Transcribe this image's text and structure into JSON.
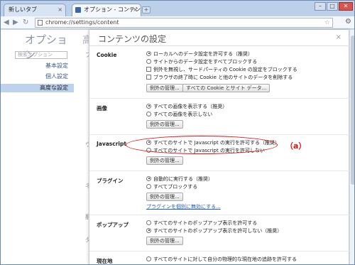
{
  "browser": {
    "tabs": [
      {
        "label": "新しいタブ",
        "active": false
      },
      {
        "label": "オプション - コンテンツ...",
        "active": true
      }
    ],
    "url": "chrome://settings/content",
    "window_buttons": {
      "minimize": "–",
      "maximize": "□",
      "close": "✕"
    }
  },
  "sidebar": {
    "title": "オプション",
    "search_placeholder": "検索オプション",
    "items": [
      {
        "label": "基本設定",
        "selected": false
      },
      {
        "label": "個人設定",
        "selected": false
      },
      {
        "label": "高度な設定",
        "selected": true
      }
    ],
    "behind_fragments": [
      "高",
      "プ",
      "ウ",
      "ネ",
      "翻",
      "ダ"
    ]
  },
  "dialog": {
    "title": "コンテンツの設定",
    "close": "×",
    "sections": {
      "cookie": {
        "label": "Cookie",
        "options": [
          "ローカルへのデータ設定を許可する（推奨）",
          "サイトからのデータ設定をすべてブロックする",
          "例外を無視し、サードパーティの Cookie の設定をブロックする",
          "ブラウザの終了時に Cookie と他のサイトのデータを削除する"
        ],
        "buttons": [
          "例外の管理...",
          "すべての Cookie とサイト データ..."
        ]
      },
      "images": {
        "label": "画像",
        "options": [
          "すべての画像を表示する（推奨）",
          "すべての画像を表示しない"
        ],
        "button": "例外の管理..."
      },
      "javascript": {
        "label": "Javascript",
        "options": [
          "すべてのサイトで Javascript の実行を許可する（推奨）",
          "すべてのサイトで Javascript の実行を許可しない"
        ],
        "button": "例外の管理..."
      },
      "plugins": {
        "label": "プラグイン",
        "options": [
          "自動的に実行する（推奨）",
          "すべてブロックする"
        ],
        "button": "例外の管理...",
        "link": "プラグインを個別に無効にする..."
      },
      "popups": {
        "label": "ポップアップ",
        "options": [
          "すべてのサイトのポップアップ表示を許可する",
          "すべてのサイトのポップアップ表示を許可しない（推奨）"
        ],
        "button": "例外の管理..."
      },
      "location": {
        "label": "現在地",
        "options": [
          "すべてのサイトに対して自分の物理的な現在地の追跡を許可する"
        ]
      }
    }
  },
  "annotation": {
    "label": "（a）",
    "color": "#e01010"
  }
}
